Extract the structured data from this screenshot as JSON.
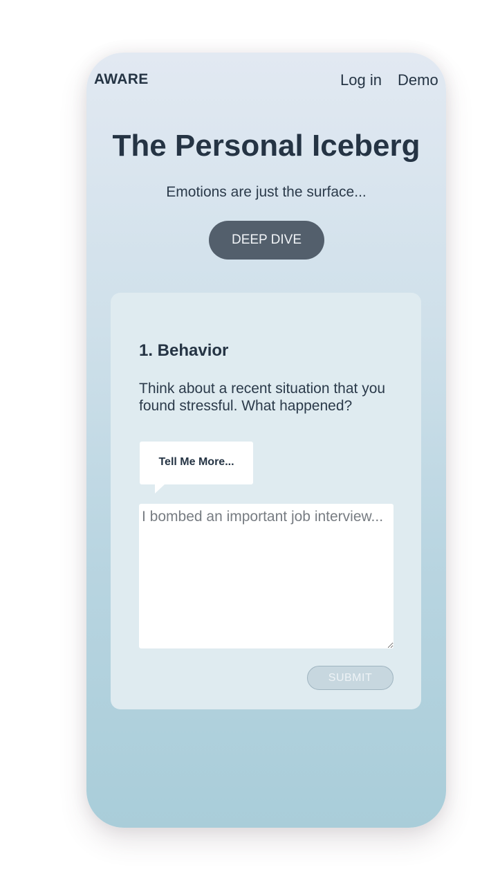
{
  "nav": {
    "brand": "AWARE",
    "login_label": "Log in",
    "demo_label": "Demo"
  },
  "hero": {
    "title": "The Personal Iceberg",
    "subtitle": "Emotions are just the surface...",
    "cta_label": "DEEP DIVE"
  },
  "card": {
    "step_title": "1. Behavior",
    "question": "Think about a recent situation that you found stressful. What happened?",
    "tell_more_label": "Tell Me More...",
    "answer_placeholder": "I bombed an important job interview...",
    "answer_value": "",
    "submit_label": "SUBMIT"
  },
  "colors": {
    "text_dark": "#253444",
    "cta_background": "#535f6c",
    "card_background": "#dfebf0",
    "submit_background": "#c7d7df",
    "gradient_top": "#e2e9f2",
    "gradient_bottom": "#a9cdd9"
  }
}
